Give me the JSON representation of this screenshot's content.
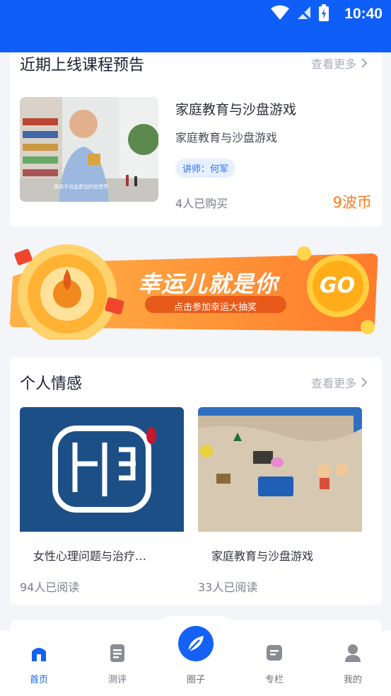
{
  "status_bar": {
    "time": "10:40"
  },
  "upcoming": {
    "title": "近期上线课程预告",
    "more": "查看更多",
    "course": {
      "title": "家庭教育与沙盘游戏",
      "subtitle": "家庭教育与沙盘游戏",
      "teacher": "讲师：何军",
      "buyers": "4人已购买",
      "price": "9波币",
      "thumb_caption": "那孩子也会更加的自觉学"
    }
  },
  "banner": {
    "headline": "幸运儿就是你",
    "subline": "点击参加幸运大抽奖",
    "go": "GO"
  },
  "emotion": {
    "title": "个人情感",
    "more": "查看更多",
    "items": [
      {
        "title": "女性心理问题与治疗…",
        "reads": "94人已阅读"
      },
      {
        "title": "家庭教育与沙盘游戏",
        "reads": "33人已阅读"
      }
    ]
  },
  "tabbar": {
    "tabs": [
      {
        "label": "首页",
        "icon": "home-icon"
      },
      {
        "label": "测评",
        "icon": "document-icon"
      },
      {
        "label": "圈子",
        "icon": "circle-feather-icon"
      },
      {
        "label": "专栏",
        "icon": "column-icon"
      },
      {
        "label": "我的",
        "icon": "user-icon"
      }
    ]
  },
  "colors": {
    "primary": "#1561f3",
    "status_bar": "#0f5ef7",
    "price": "#ff7a1a",
    "tag_bg": "#e7f0ff"
  }
}
